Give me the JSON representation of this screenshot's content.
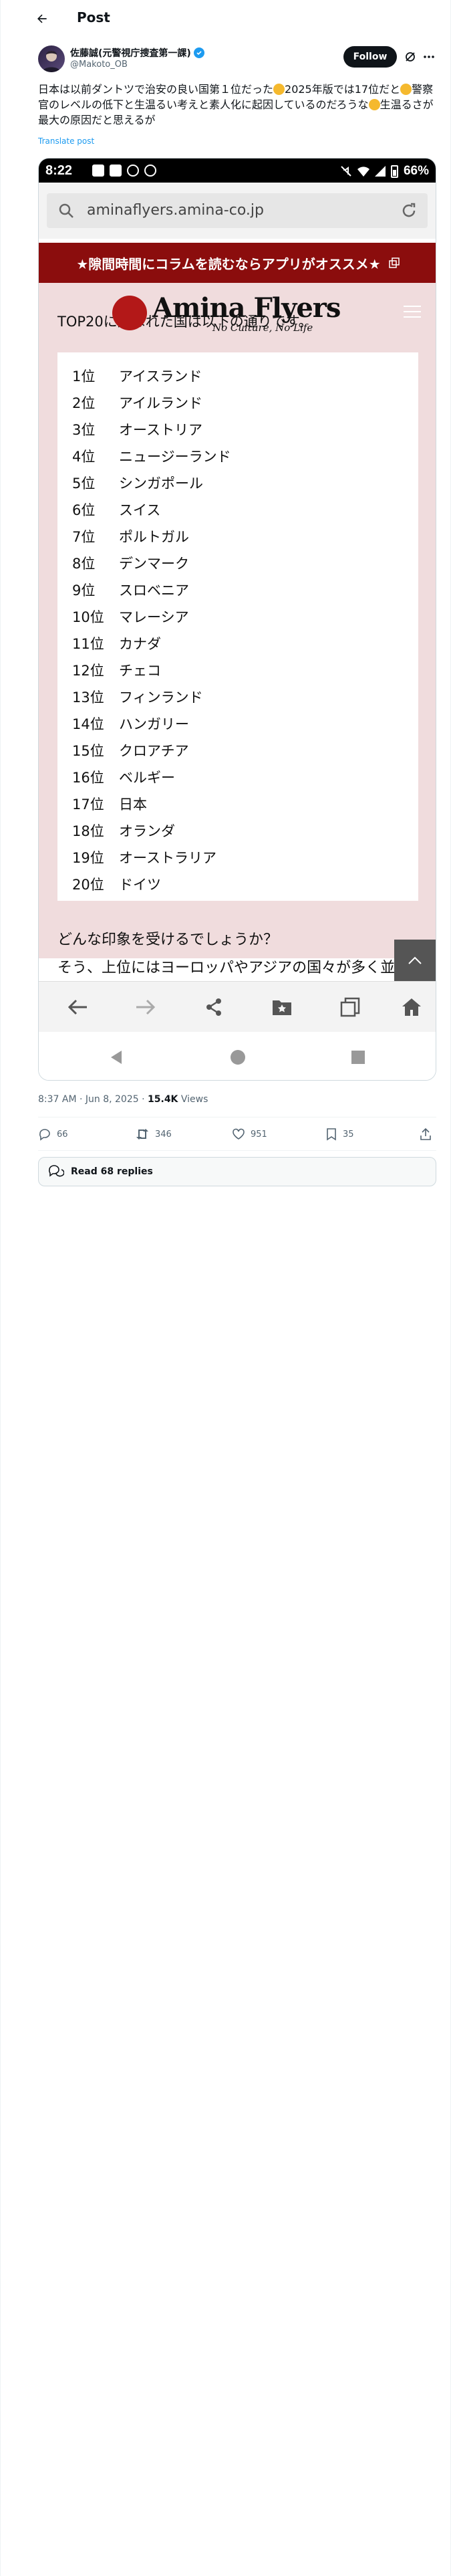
{
  "header": {
    "title": "Post"
  },
  "author": {
    "name": "佐藤誠(元警視庁捜査第一課)",
    "handle": "@Makoto_OB",
    "follow_label": "Follow"
  },
  "tweet": {
    "text_part1": "日本は以前ダントツで治安の良い国第１位だった",
    "text_part2": "2025年版では17位だと",
    "text_part3": "警察官のレベルの低下と生温るい考えと素人化に起因しているのだろうな",
    "text_part4": "生温るさが最大の原因だと思えるが",
    "translate_label": "Translate post"
  },
  "screenshot": {
    "status_time": "8:22",
    "battery": "66%",
    "url": "aminaflyers.amina-co.jp",
    "banner_text": "★隙間時間にコラムを読むならアプリがオススメ★",
    "logo_title": "Amina Flyers",
    "logo_subtitle": "No Culture, No Life",
    "heading": "TOP20に選ばれた国は以下の通りです。",
    "rankings": [
      {
        "rank": "1位",
        "country": "アイスランド"
      },
      {
        "rank": "2位",
        "country": "アイルランド"
      },
      {
        "rank": "3位",
        "country": "オーストリア"
      },
      {
        "rank": "4位",
        "country": "ニュージーランド"
      },
      {
        "rank": "5位",
        "country": "シンガポール"
      },
      {
        "rank": "6位",
        "country": "スイス"
      },
      {
        "rank": "7位",
        "country": "ポルトガル"
      },
      {
        "rank": "8位",
        "country": "デンマーク"
      },
      {
        "rank": "9位",
        "country": "スロベニア"
      },
      {
        "rank": "10位",
        "country": "マレーシア"
      },
      {
        "rank": "11位",
        "country": "カナダ"
      },
      {
        "rank": "12位",
        "country": "チェコ"
      },
      {
        "rank": "13位",
        "country": "フィンランド"
      },
      {
        "rank": "14位",
        "country": "ハンガリー"
      },
      {
        "rank": "15位",
        "country": "クロアチア"
      },
      {
        "rank": "16位",
        "country": "ベルギー"
      },
      {
        "rank": "17位",
        "country": "日本"
      },
      {
        "rank": "18位",
        "country": "オランダ"
      },
      {
        "rank": "19位",
        "country": "オーストラリア"
      },
      {
        "rank": "20位",
        "country": "ドイツ"
      }
    ],
    "question": "どんな印象を受けるでしょうか？",
    "answer": "そう、上位にはヨーロッパやアジアの国々が多く並"
  },
  "meta": {
    "time": "8:37 AM · Jun 8, 2025 · ",
    "views_count": "15.4K",
    "views_label": " Views"
  },
  "actions": {
    "replies": "66",
    "reposts": "346",
    "likes": "951",
    "bookmarks": "35"
  },
  "read_replies_label": "Read 68 replies",
  "colors": {
    "accent": "#1d9bf0",
    "banner": "#8b0d0d",
    "page_bg": "#f0dcdd"
  }
}
